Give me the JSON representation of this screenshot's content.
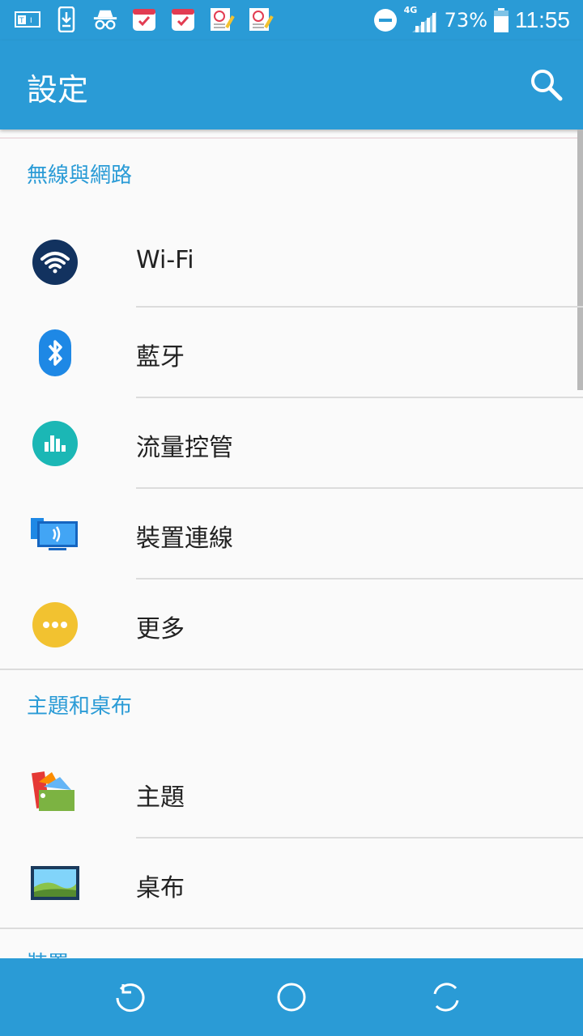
{
  "status_bar": {
    "battery": "73%",
    "time": "11:55",
    "network": "4G",
    "left_icons": [
      "t-box-icon",
      "download-phone-icon",
      "incognito-icon",
      "calendar-check-icon",
      "calendar-check-icon",
      "notepad-icon",
      "notepad-icon"
    ]
  },
  "app_bar": {
    "title": "設定"
  },
  "sections": [
    {
      "header": "無線與網路",
      "items": [
        {
          "label": "Wi-Fi",
          "icon": "wifi-icon"
        },
        {
          "label": "藍牙",
          "icon": "bluetooth-icon"
        },
        {
          "label": "流量控管",
          "icon": "data-usage-icon"
        },
        {
          "label": "裝置連線",
          "icon": "device-connection-icon"
        },
        {
          "label": "更多",
          "icon": "more-icon"
        }
      ]
    },
    {
      "header": "主題和桌布",
      "items": [
        {
          "label": "主題",
          "icon": "themes-icon"
        },
        {
          "label": "桌布",
          "icon": "wallpaper-icon"
        }
      ]
    },
    {
      "header": "裝置",
      "items": []
    }
  ],
  "colors": {
    "primary": "#2a9bd6",
    "section_header": "#2a9bd6",
    "background": "#fafafa"
  }
}
